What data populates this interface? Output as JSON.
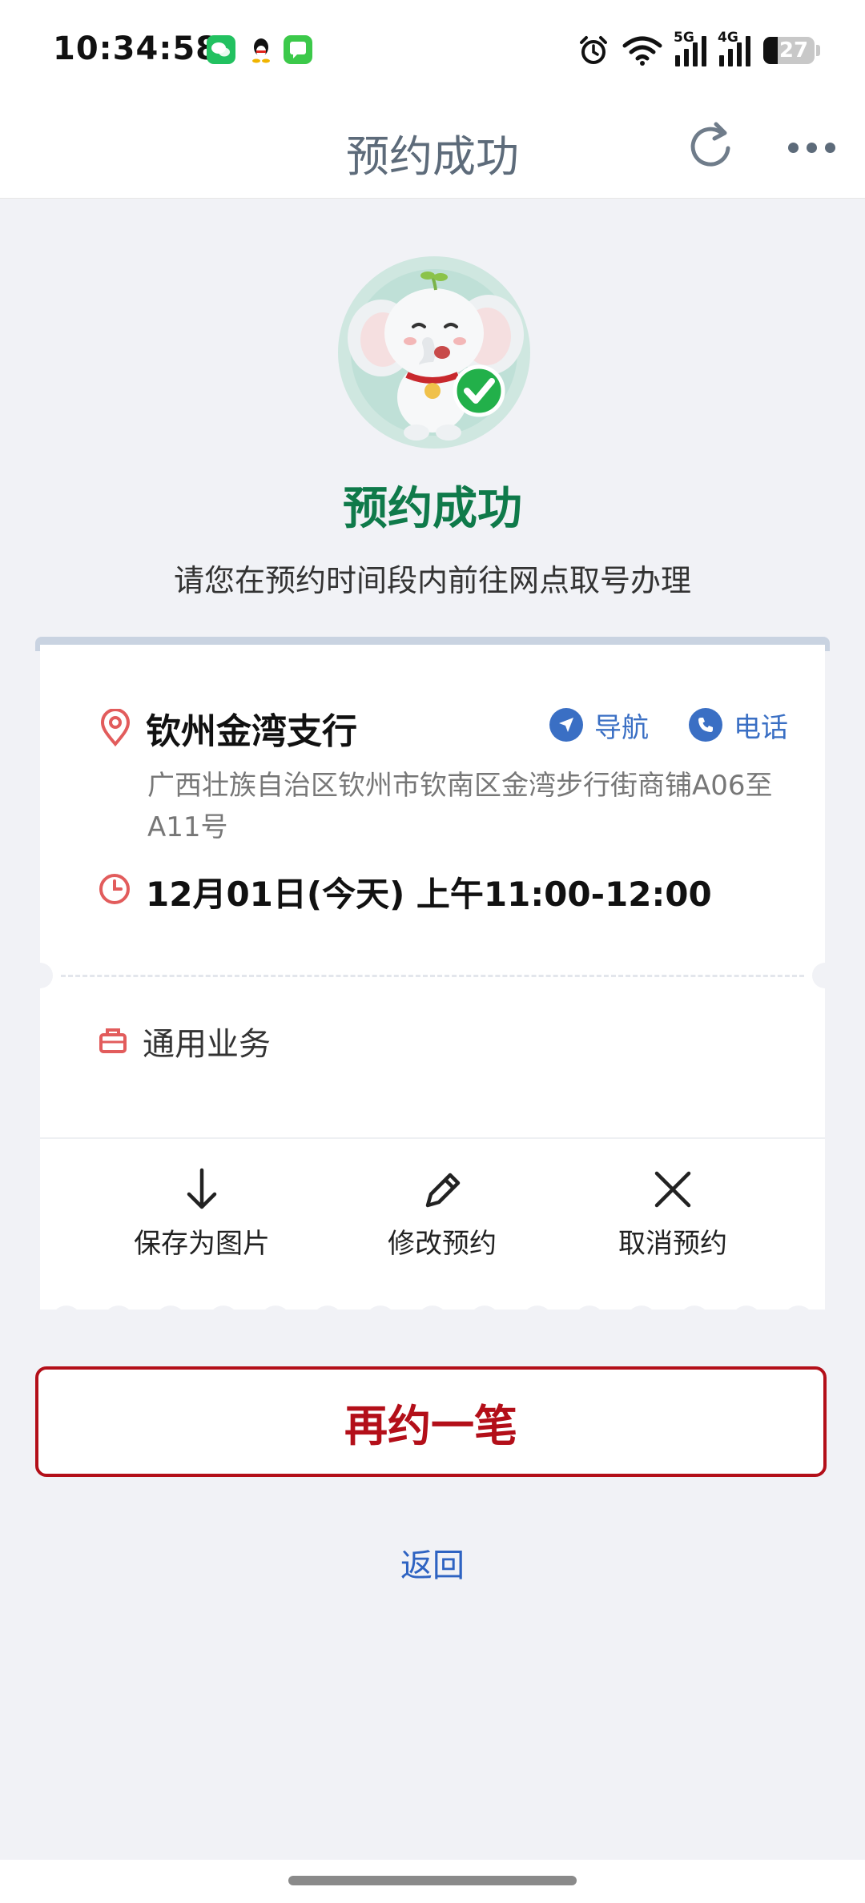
{
  "status_bar": {
    "time": "10:34:58",
    "apps": [
      {
        "icon": "wechat-icon",
        "color": "#22c160"
      },
      {
        "icon": "qq-icon",
        "color": "#111111"
      },
      {
        "icon": "messages-icon",
        "color": "#3cc94a"
      }
    ],
    "network_5g": "5G",
    "network_4g": "4G",
    "battery": "27"
  },
  "nav": {
    "title": "预约成功"
  },
  "hero": {
    "title": "预约成功",
    "subtitle": "请您在预约时间段内前往网点取号办理"
  },
  "ticket": {
    "branch_name": "钦州金湾支行",
    "navigate_label": "导航",
    "phone_label": "电话",
    "address": "广西壮族自治区钦州市钦南区金湾步行街商铺A06至A11号",
    "time_slot": "12月01日(今天) 上午11:00-12:00",
    "business_type": "通用业务",
    "actions": {
      "save": "保存为图片",
      "modify": "修改预约",
      "cancel": "取消预约"
    }
  },
  "buttons": {
    "rebook": "再约一笔",
    "back": "返回"
  },
  "colors": {
    "accent_red": "#b30f19",
    "success_green": "#0f7a4a",
    "link_blue": "#3a6fc4",
    "background": "#f1f2f6"
  }
}
